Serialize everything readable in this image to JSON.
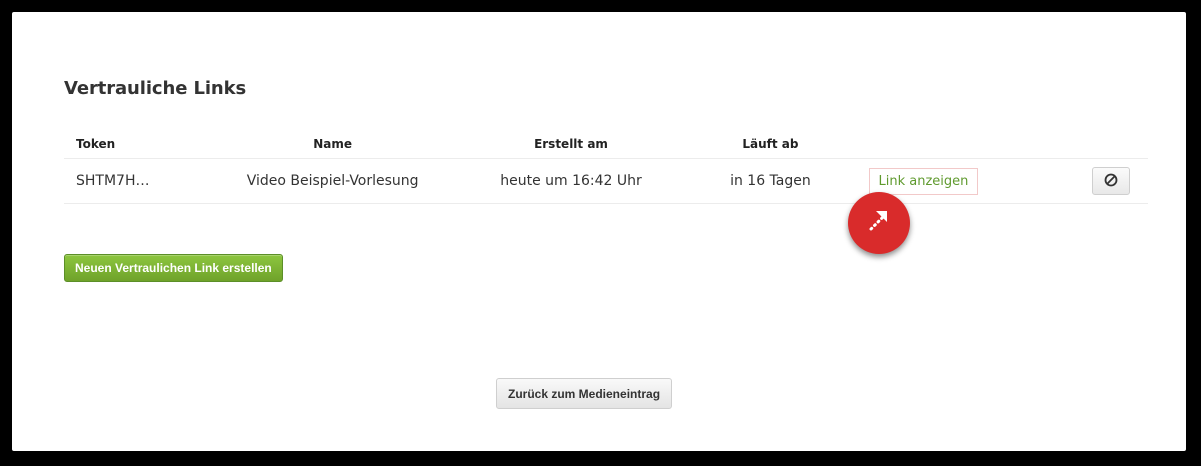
{
  "page": {
    "title": "Vertrauliche Links"
  },
  "table": {
    "columns": [
      "Token",
      "Name",
      "Erstellt am",
      "Läuft ab"
    ],
    "rows": [
      {
        "token": "SHTM7H…",
        "name": "Video Beispiel-Vorlesung",
        "created": "heute um 16:42 Uhr",
        "expires": "in 16 Tagen",
        "link_label": "Link anzeigen"
      }
    ]
  },
  "actions": {
    "create_label": "Neuen Vertraulichen Link erstellen",
    "back_label": "Zurück zum Medieneintrag"
  },
  "icons": {
    "revoke": "circle-slash-icon",
    "highlight": "arrow-up-right-icon"
  },
  "colors": {
    "green": "#6fa22a",
    "link_green": "#5f9a2e",
    "highlight_red": "#d92b2b"
  }
}
